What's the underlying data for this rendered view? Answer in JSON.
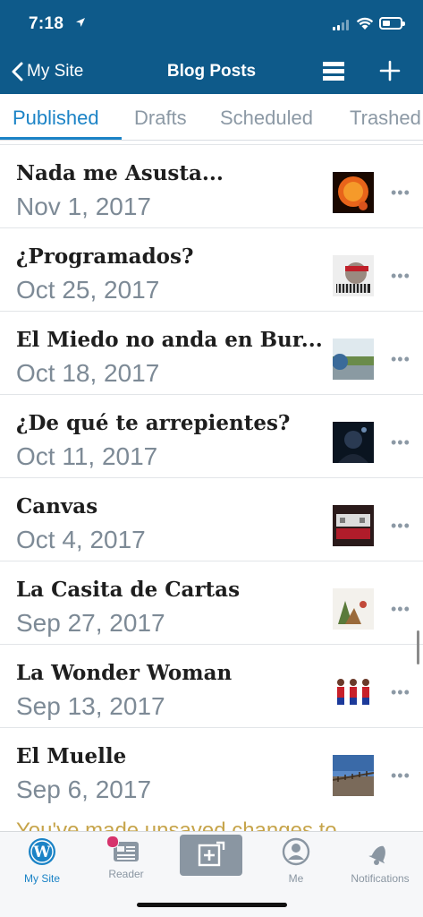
{
  "status_bar": {
    "time": "7:18"
  },
  "nav": {
    "back_label": "My Site",
    "title": "Blog Posts"
  },
  "tabs": [
    {
      "label": "Published",
      "active": true
    },
    {
      "label": "Drafts",
      "active": false
    },
    {
      "label": "Scheduled",
      "active": false
    },
    {
      "label": "Trashed",
      "active": false
    }
  ],
  "posts": [
    {
      "title": "Nada me Asusta...",
      "date": "Nov 1, 2017"
    },
    {
      "title": "¿Programados?",
      "date": "Oct 25, 2017"
    },
    {
      "title": "El Miedo no anda en Bur...",
      "date": "Oct 18, 2017"
    },
    {
      "title": "¿De qué te arrepientes?",
      "date": "Oct 11, 2017"
    },
    {
      "title": "Canvas",
      "date": "Oct 4, 2017"
    },
    {
      "title": "La Casita de Cartas",
      "date": "Sep 27, 2017"
    },
    {
      "title": "La Wonder Woman",
      "date": "Sep 13, 2017"
    },
    {
      "title": "El Muelle",
      "date": "Sep 6, 2017"
    }
  ],
  "notice": "You've made unsaved changes to",
  "tab_bar": [
    {
      "label": "My Site",
      "icon": "wordpress-icon",
      "active": true
    },
    {
      "label": "Reader",
      "icon": "reader-icon",
      "active": false
    },
    {
      "label": "",
      "icon": "new-post-icon",
      "active": false
    },
    {
      "label": "Me",
      "icon": "me-icon",
      "active": false
    },
    {
      "label": "Notifications",
      "icon": "notifications-bell-icon",
      "active": false
    }
  ],
  "colors": {
    "header": "#0e5a8a",
    "accent": "#1b83c6",
    "muted": "#8c99a5",
    "notice": "#c6a44a",
    "unread_dot": "#d6336c"
  }
}
